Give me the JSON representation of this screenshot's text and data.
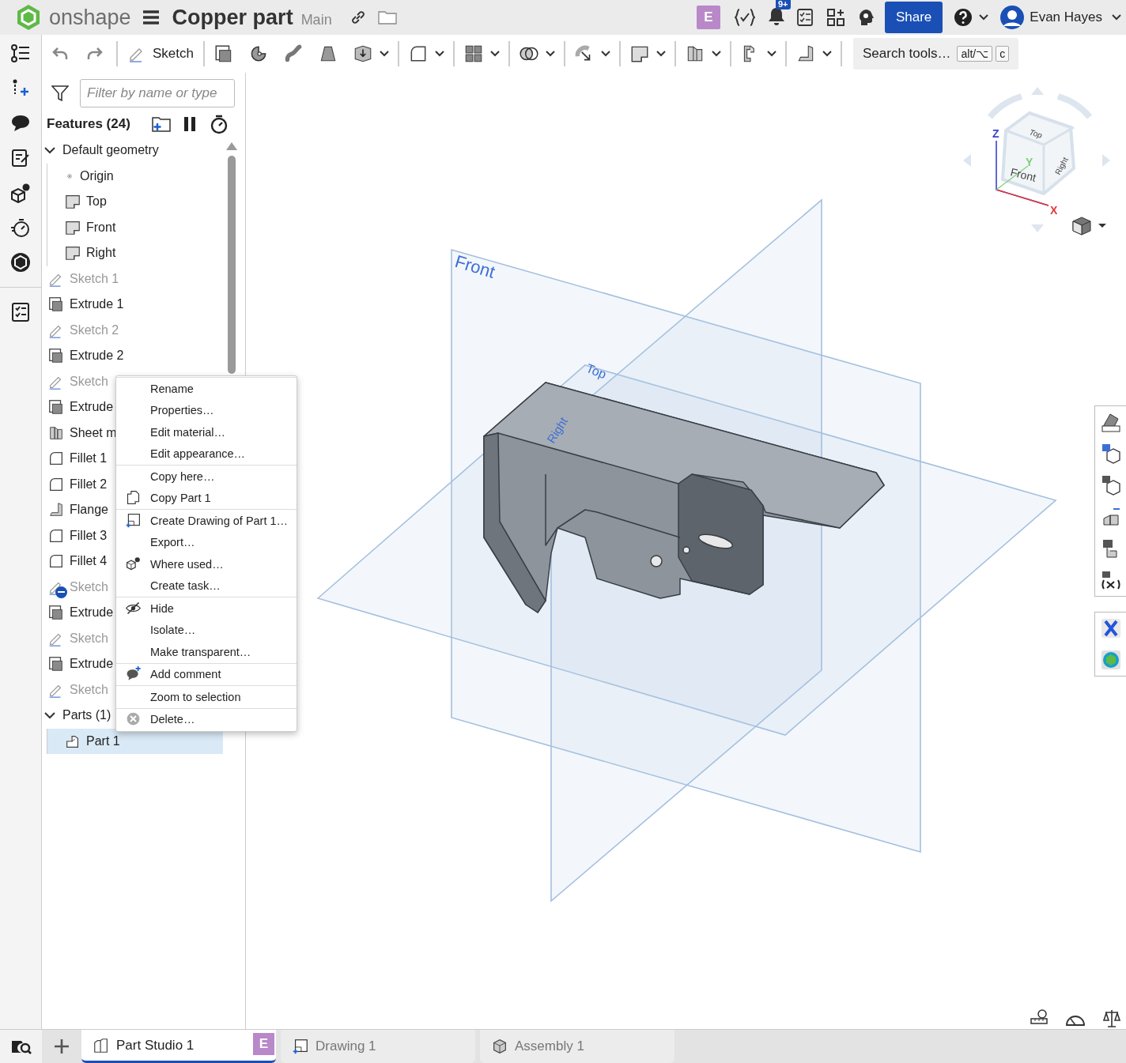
{
  "header": {
    "logo_text": "onshape",
    "document_title": "Copper part",
    "branch": "Main",
    "workspace_badge": "E",
    "notification_count": "9+",
    "share_button": "Share",
    "user_name": "Evan Hayes"
  },
  "toolbar": {
    "sketch_button": "Sketch",
    "tools": [
      {
        "kind": "extrude",
        "dropdown": false
      },
      {
        "kind": "revolve",
        "dropdown": false
      },
      {
        "kind": "sweep",
        "dropdown": false
      },
      {
        "kind": "loft",
        "dropdown": false
      },
      {
        "kind": "thicken",
        "dropdown": true
      },
      {
        "kind": "fillet",
        "dropdown": true
      },
      {
        "kind": "pattern",
        "dropdown": true
      },
      {
        "kind": "boolean",
        "dropdown": true
      },
      {
        "kind": "transform",
        "dropdown": true
      },
      {
        "kind": "plane",
        "dropdown": true
      },
      {
        "kind": "sheet-metal",
        "dropdown": true
      },
      {
        "kind": "sheet-metal-model",
        "dropdown": true
      },
      {
        "kind": "flange",
        "dropdown": true
      }
    ],
    "search_label": "Search tools…",
    "shortcut_keys": [
      "alt/⌥",
      "c"
    ]
  },
  "feature_panel": {
    "filter_placeholder": "Filter by name or type",
    "title": "Features (24)",
    "tree": [
      {
        "kind": "group",
        "label": "Default geometry",
        "expanded": true,
        "selected": false,
        "minus_badge": false,
        "children": [
          {
            "kind": "origin",
            "label": "Origin",
            "selected": false,
            "minus_badge": false
          },
          {
            "kind": "plane",
            "label": "Top",
            "selected": false,
            "minus_badge": false
          },
          {
            "kind": "plane",
            "label": "Front",
            "selected": false,
            "minus_badge": false
          },
          {
            "kind": "plane",
            "label": "Right",
            "selected": false,
            "minus_badge": false
          }
        ]
      },
      {
        "kind": "sketch",
        "label": "Sketch 1",
        "selected": false,
        "minus_badge": false
      },
      {
        "kind": "extrude",
        "label": "Extrude 1",
        "selected": false,
        "minus_badge": false
      },
      {
        "kind": "sketch",
        "label": "Sketch 2",
        "selected": false,
        "minus_badge": false
      },
      {
        "kind": "extrude",
        "label": "Extrude 2",
        "selected": false,
        "minus_badge": false
      },
      {
        "kind": "sketch",
        "label": "Sketch",
        "selected": false,
        "minus_badge": false
      },
      {
        "kind": "extrude",
        "label": "Extrude",
        "selected": false,
        "minus_badge": false
      },
      {
        "kind": "sheet-metal",
        "label": "Sheet m",
        "selected": false,
        "minus_badge": false
      },
      {
        "kind": "fillet",
        "label": "Fillet 1",
        "selected": false,
        "minus_badge": false
      },
      {
        "kind": "fillet",
        "label": "Fillet 2",
        "selected": false,
        "minus_badge": false
      },
      {
        "kind": "flange",
        "label": "Flange",
        "selected": false,
        "minus_badge": false
      },
      {
        "kind": "fillet",
        "label": "Fillet 3",
        "selected": false,
        "minus_badge": false
      },
      {
        "kind": "fillet",
        "label": "Fillet 4",
        "selected": false,
        "minus_badge": false
      },
      {
        "kind": "sketch",
        "label": "Sketch",
        "selected": false,
        "minus_badge": true
      },
      {
        "kind": "extrude",
        "label": "Extrude",
        "selected": false,
        "minus_badge": false
      },
      {
        "kind": "sketch",
        "label": "Sketch",
        "selected": false,
        "minus_badge": false
      },
      {
        "kind": "extrude",
        "label": "Extrude",
        "selected": false,
        "minus_badge": false
      },
      {
        "kind": "sketch",
        "label": "Sketch",
        "selected": false,
        "minus_badge": false
      },
      {
        "kind": "group",
        "label": "Parts (1)",
        "expanded": true,
        "selected": false,
        "minus_badge": false,
        "children": [
          {
            "kind": "part",
            "label": "Part 1",
            "selected": true,
            "minus_badge": false
          }
        ]
      }
    ]
  },
  "context_menu": {
    "groups": [
      [
        {
          "kind": "plain",
          "label": "Rename"
        },
        {
          "kind": "plain",
          "label": "Properties…"
        },
        {
          "kind": "plain",
          "label": "Edit material…"
        },
        {
          "kind": "plain",
          "label": "Edit appearance…"
        }
      ],
      [
        {
          "kind": "plain",
          "label": "Copy here…"
        },
        {
          "kind": "copy",
          "label": "Copy Part 1"
        }
      ],
      [
        {
          "kind": "drawing",
          "label": "Create Drawing of Part 1…"
        },
        {
          "kind": "plain",
          "label": "Export…"
        },
        {
          "kind": "where-used",
          "label": "Where used…"
        },
        {
          "kind": "plain",
          "label": "Create task…"
        }
      ],
      [
        {
          "kind": "hide",
          "label": "Hide"
        },
        {
          "kind": "plain",
          "label": "Isolate…"
        },
        {
          "kind": "plain",
          "label": "Make transparent…"
        }
      ],
      [
        {
          "kind": "comment",
          "label": "Add comment"
        }
      ],
      [
        {
          "kind": "plain",
          "label": "Zoom to selection"
        }
      ],
      [
        {
          "kind": "delete",
          "label": "Delete…"
        }
      ]
    ]
  },
  "viewport": {
    "planes": [
      {
        "kind": "front",
        "label": "Front"
      },
      {
        "kind": "top",
        "label": "Top"
      },
      {
        "kind": "right",
        "label": "Right"
      }
    ],
    "view_cube": {
      "faces": [
        {
          "kind": "top",
          "label": "Top"
        },
        {
          "kind": "front",
          "label": "Front"
        },
        {
          "kind": "right",
          "label": "Right"
        }
      ],
      "axes": [
        {
          "kind": "z",
          "label": "Z"
        },
        {
          "kind": "y",
          "label": "Y"
        },
        {
          "kind": "x",
          "label": "X"
        }
      ]
    }
  },
  "bottom_tabs": [
    {
      "kind": "part-studio",
      "label": "Part Studio 1",
      "selected": true,
      "badge": "E"
    },
    {
      "kind": "drawing",
      "label": "Drawing 1",
      "selected": false
    },
    {
      "kind": "assembly",
      "label": "Assembly 1",
      "selected": false
    }
  ]
}
